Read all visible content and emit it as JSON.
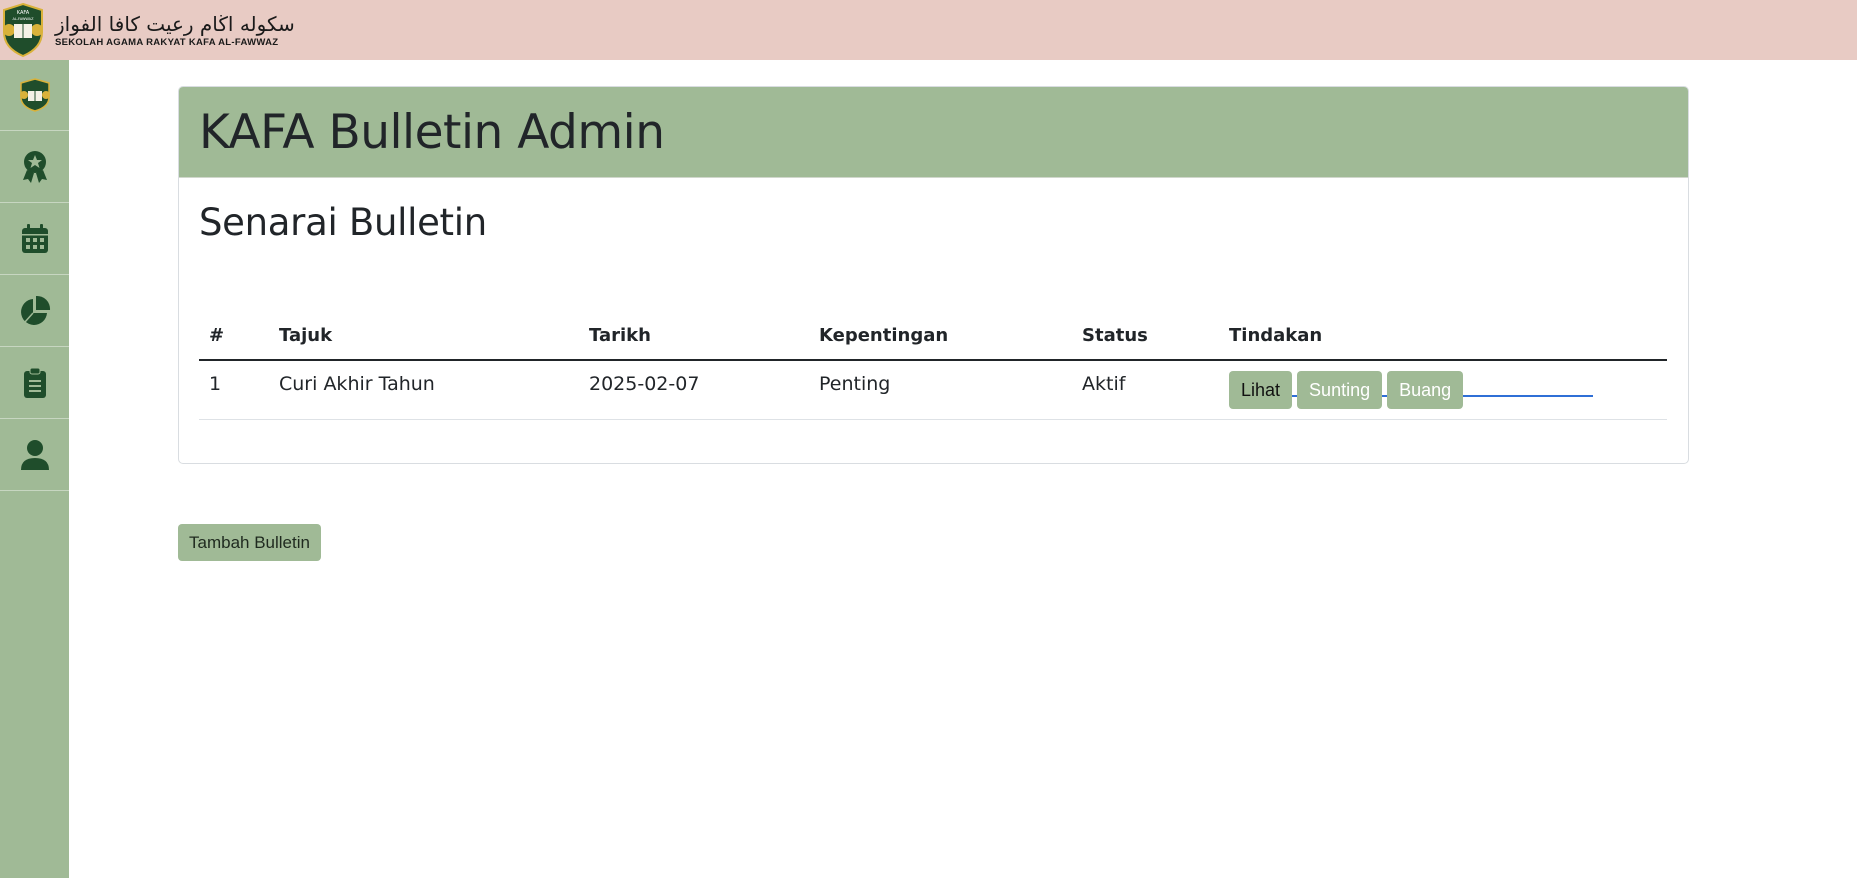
{
  "header": {
    "brand_arabic": "سكوله اڬام رعيت كافا الفواز",
    "brand_sub": "SEKOLAH AGAMA RAKYAT KAFA AL-FAWWAZ",
    "logo_lines": [
      "KAFA",
      "AL-FAWWAZ"
    ]
  },
  "sidebar": {
    "items": [
      {
        "icon": "school-logo-icon"
      },
      {
        "icon": "award-icon"
      },
      {
        "icon": "calendar-icon"
      },
      {
        "icon": "pie-chart-icon"
      },
      {
        "icon": "clipboard-icon"
      },
      {
        "icon": "user-icon"
      }
    ]
  },
  "card": {
    "title": "KAFA Bulletin Admin",
    "section_title": "Senarai Bulletin"
  },
  "table": {
    "headers": [
      "#",
      "Tajuk",
      "Tarikh",
      "Kepentingan",
      "Status",
      "Tindakan"
    ],
    "rows": [
      {
        "num": "1",
        "tajuk": "Curi Akhir Tahun",
        "tarikh": "2025-02-07",
        "kepentingan": "Penting",
        "status": "Aktif",
        "actions": {
          "view": "Lihat",
          "edit": "Sunting",
          "delete": "Buang"
        }
      }
    ]
  },
  "add_button": "Tambah Bulletin",
  "colors": {
    "topbar": "#e8cbc4",
    "sidebar": "#a0ba96",
    "accent_green": "#a0ba96",
    "icon_dark_green": "#1f4d2b"
  }
}
